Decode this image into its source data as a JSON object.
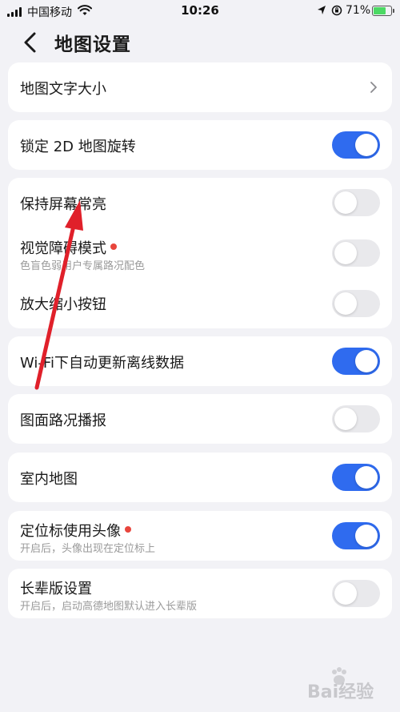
{
  "status_bar": {
    "carrier": "中国移动",
    "time": "10:26",
    "battery_percent": "71%",
    "battery_level": 0.71,
    "icons": [
      "signal-icon",
      "wifi-icon",
      "location-icon",
      "orientation-lock-icon",
      "battery-charging-icon"
    ]
  },
  "header": {
    "back_icon": "chevron-left-icon",
    "title": "地图设置"
  },
  "settings": {
    "map_text_size": {
      "label": "地图文字大小",
      "icon": "chevron-right-icon"
    },
    "lock_2d_rotation": {
      "label": "锁定 2D 地图旋转",
      "on": true
    },
    "keep_screen_on": {
      "label": "保持屏幕常亮",
      "on": false
    },
    "visual_impairment_mode": {
      "label": "视觉障碍模式",
      "subtitle": "色盲色弱用户专属路况配色",
      "badge": true,
      "on": false
    },
    "zoom_buttons": {
      "label": "放大缩小按钮",
      "on": false
    },
    "wifi_auto_update": {
      "label": "Wi-Fi下自动更新离线数据",
      "on": true
    },
    "traffic_broadcast": {
      "label": "图面路况播报",
      "on": false
    },
    "indoor_map": {
      "label": "室内地图",
      "on": true
    },
    "avatar_locator": {
      "label": "定位标使用头像",
      "subtitle": "开启后，头像出现在定位标上",
      "badge": true,
      "on": true
    },
    "elder_mode": {
      "label": "长辈版设置",
      "subtitle": "开启后，启动高德地图默认进入长辈版",
      "on": false
    }
  },
  "colors": {
    "accent": "#2f6bef",
    "toggle_off": "#e9e9ec",
    "badge": "#e8453c",
    "annotation_arrow": "#e0202a",
    "background": "#f2f2f6"
  },
  "watermark": {
    "text": "Bai经验",
    "logo": "baidu-paw-icon"
  }
}
